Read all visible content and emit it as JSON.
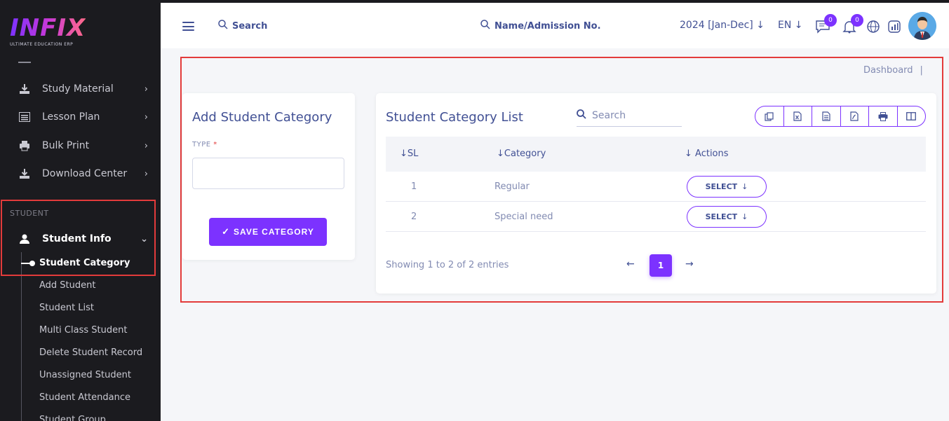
{
  "brand": {
    "logo_text": "INFIX",
    "tagline": "ULTIMATE EDUCATION ERP"
  },
  "sidebar": {
    "items": [
      {
        "label": "Study Material",
        "icon": "download-icon"
      },
      {
        "label": "Lesson Plan",
        "icon": "list-icon"
      },
      {
        "label": "Bulk Print",
        "icon": "printer-icon"
      },
      {
        "label": "Download Center",
        "icon": "download-icon"
      }
    ],
    "section_heading": "STUDENT",
    "student_info": {
      "label": "Student Info",
      "icon": "user-icon"
    },
    "sub_items": [
      "Student Category",
      "Add Student",
      "Student List",
      "Multi Class Student",
      "Delete Student Record",
      "Unassigned Student",
      "Student Attendance",
      "Student Group"
    ]
  },
  "header": {
    "search_label": "Search",
    "admission_search_label": "Name/Admission No.",
    "session": "2024 [Jan-Dec]",
    "language": "EN",
    "messages_count": "0",
    "notifications_count": "0"
  },
  "breadcrumb": {
    "item": "Dashboard",
    "separator": "|"
  },
  "add_form": {
    "title": "Add Student Category",
    "type_label": "TYPE",
    "required_mark": "*",
    "type_value": "",
    "save_label": "SAVE CATEGORY"
  },
  "list": {
    "title": "Student Category List",
    "search_placeholder": "Search",
    "columns": [
      "SL",
      "Category",
      "Actions"
    ],
    "rows": [
      {
        "sl": "1",
        "category": "Regular",
        "action": "SELECT"
      },
      {
        "sl": "2",
        "category": "Special need",
        "action": "SELECT"
      }
    ],
    "showing_text": "Showing 1 to 2 of 2 entries",
    "current_page": "1"
  },
  "colors": {
    "accent": "#7c32ff",
    "sidebar_bg": "#1b1b1f",
    "text_primary": "#415094",
    "highlight": "#e33b3b"
  }
}
